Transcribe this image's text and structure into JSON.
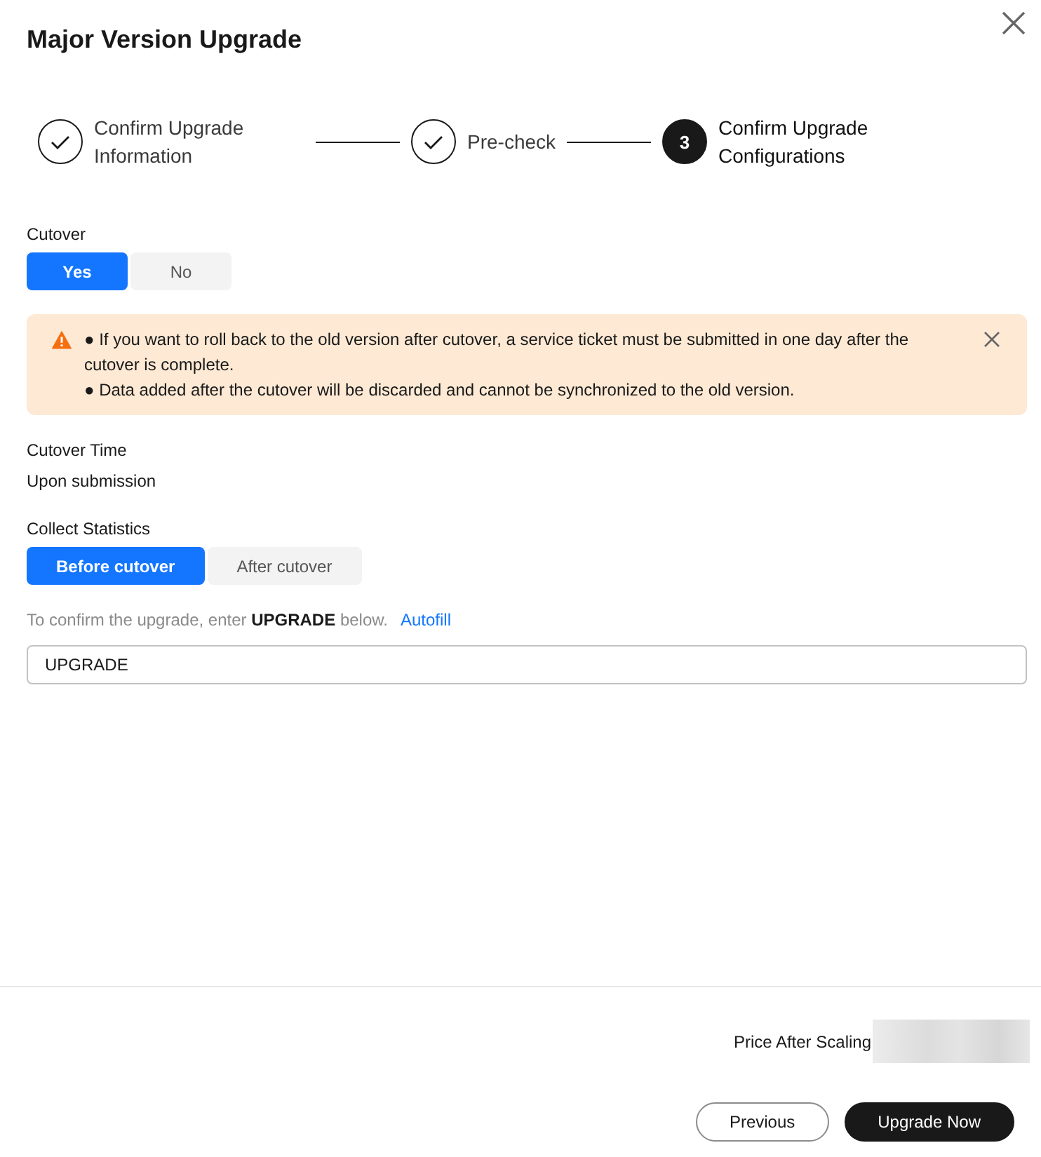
{
  "dialog": {
    "title": "Major Version Upgrade"
  },
  "steps": [
    {
      "label": "Confirm Upgrade Information",
      "completed": true,
      "selected": false
    },
    {
      "label": "Pre-check",
      "completed": true,
      "selected": false
    },
    {
      "number": "3",
      "label": "Confirm Upgrade Configurations",
      "completed": false,
      "selected": true
    }
  ],
  "cutover": {
    "label": "Cutover",
    "options": [
      {
        "label": "Yes",
        "selected": true
      },
      {
        "label": "No",
        "selected": false
      }
    ]
  },
  "alert": {
    "messages": [
      "● If you want to roll back to the old version after cutover, a service ticket must be submitted in one day after the cutover is complete.",
      "● Data added after the cutover will be discarded and cannot be synchronized to the old version."
    ]
  },
  "cutover_time": {
    "label": "Cutover Time",
    "value": "Upon submission"
  },
  "collect_statistics": {
    "label": "Collect Statistics",
    "options": [
      {
        "label": "Before cutover",
        "selected": true
      },
      {
        "label": "After cutover",
        "selected": false
      }
    ]
  },
  "confirmation": {
    "hint": "To confirm the upgrade, enter **UPGRADE** below.",
    "link": "Autofill",
    "value": "UPGRADE"
  },
  "footer": {
    "price_label": "Price After Scaling",
    "buttons": [
      {
        "label": "Previous",
        "kind": "secondary"
      },
      {
        "label": "Upgrade Now",
        "kind": "primary"
      }
    ]
  }
}
